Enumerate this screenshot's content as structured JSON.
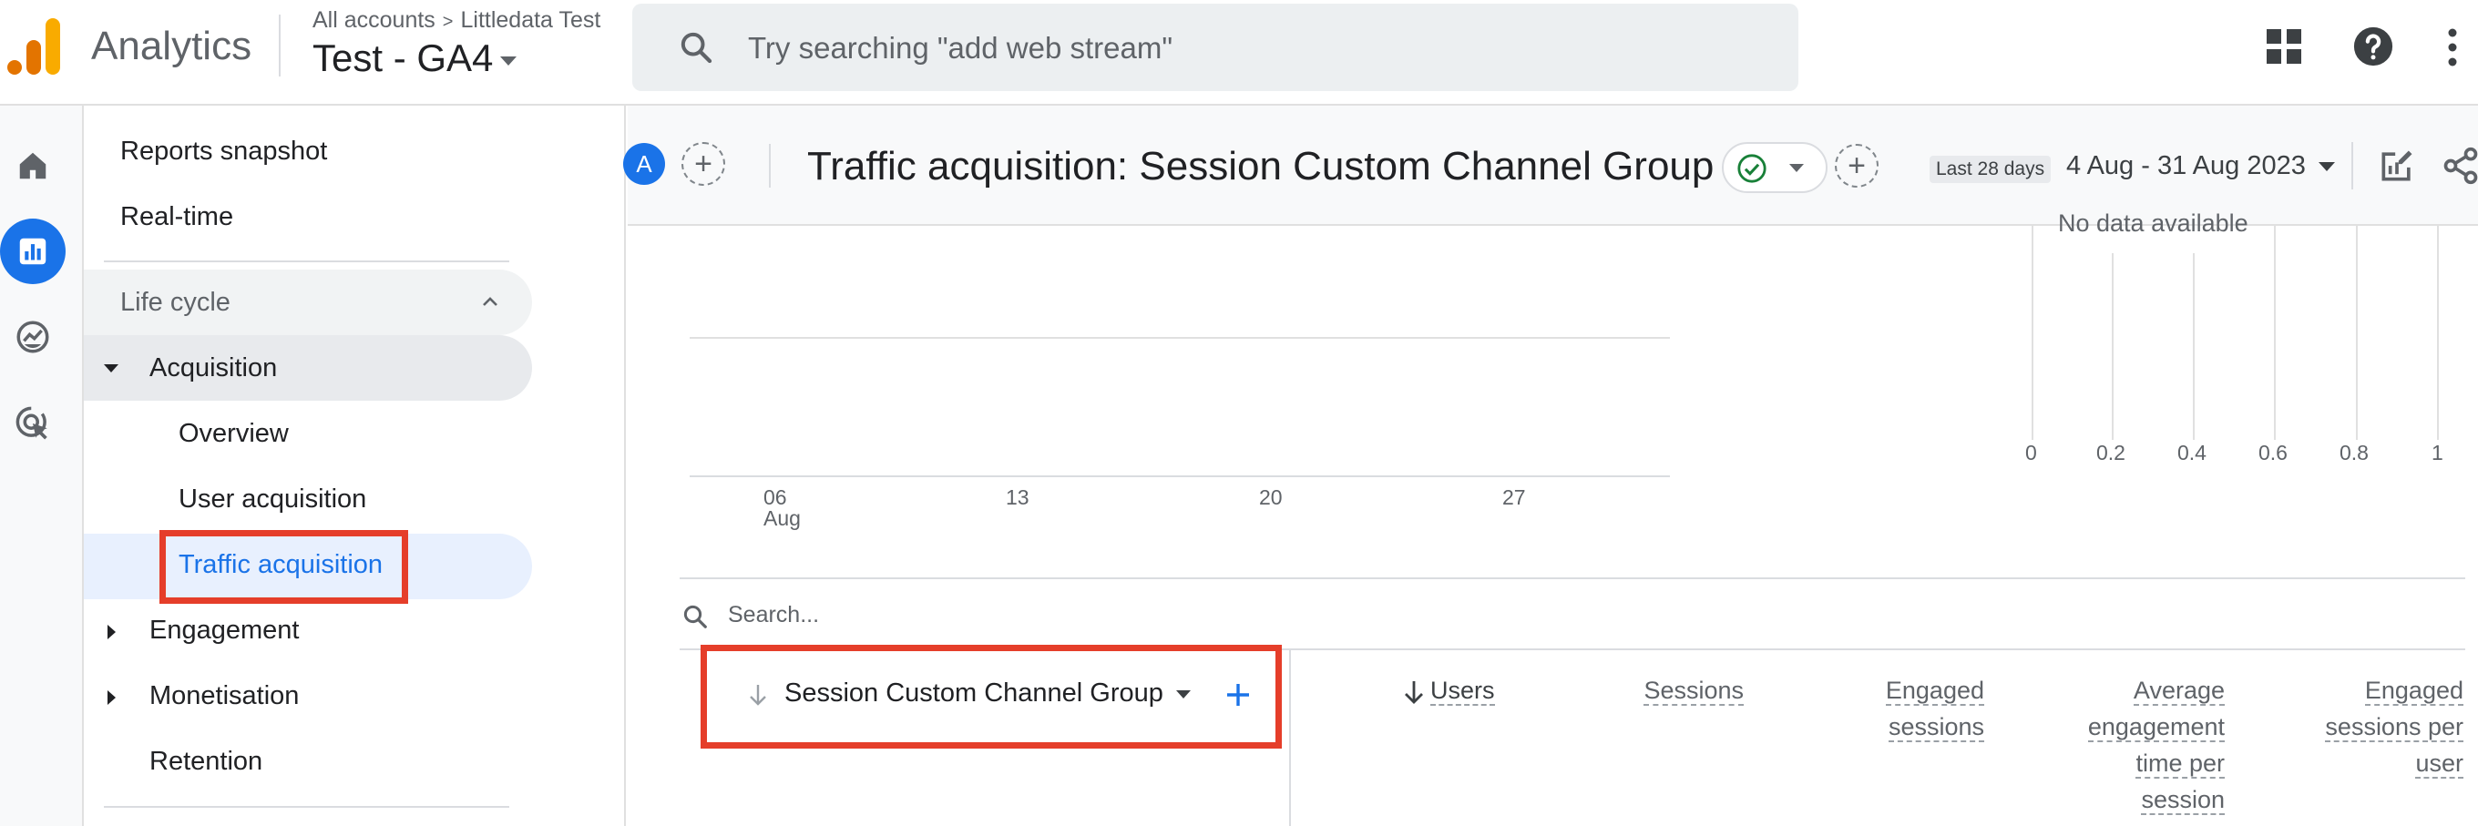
{
  "topbar": {
    "app_name": "Analytics",
    "breadcrumb_account": "All accounts",
    "breadcrumb_separator": ">",
    "breadcrumb_property": "Littledata Test",
    "property_name": "Test - GA4",
    "search_placeholder": "Try searching \"add web stream\""
  },
  "sidebar": {
    "reports_snapshot": "Reports snapshot",
    "realtime": "Real-time",
    "section_title": "Life cycle",
    "acquisition": "Acquisition",
    "overview": "Overview",
    "user_acquisition": "User acquisition",
    "traffic_acquisition": "Traffic acquisition",
    "engagement": "Engagement",
    "monetisation": "Monetisation",
    "retention": "Retention"
  },
  "report": {
    "avatar_letter": "A",
    "title": "Traffic acquisition: Session Custom Channel Group",
    "date_chip": "Last 28 days",
    "date_range": "4 Aug - 31 Aug 2023"
  },
  "chart": {
    "no_data": "No data available",
    "x_ticks": [
      {
        "day": "06",
        "month": "Aug"
      },
      {
        "day": "13",
        "month": ""
      },
      {
        "day": "20",
        "month": ""
      },
      {
        "day": "27",
        "month": ""
      }
    ],
    "bar_ticks": [
      "0",
      "0.2",
      "0.4",
      "0.6",
      "0.8",
      "1"
    ]
  },
  "table": {
    "search_placeholder": "Search...",
    "dimension_label": "Session Custom Channel Group",
    "columns": [
      {
        "line1": "Users"
      },
      {
        "line1": "Sessions"
      },
      {
        "line1": "Engaged",
        "line2": "sessions"
      },
      {
        "line1": "Average",
        "line2": "engagement",
        "line3": "time per",
        "line4": "session"
      },
      {
        "line1": "Engaged",
        "line2": "sessions per",
        "line3": "user"
      }
    ]
  },
  "colors": {
    "accent_blue": "#1a73e8",
    "highlight_red": "#e53e2a",
    "logo_orange": "#f9ab00",
    "logo_dark_orange": "#e37400"
  }
}
